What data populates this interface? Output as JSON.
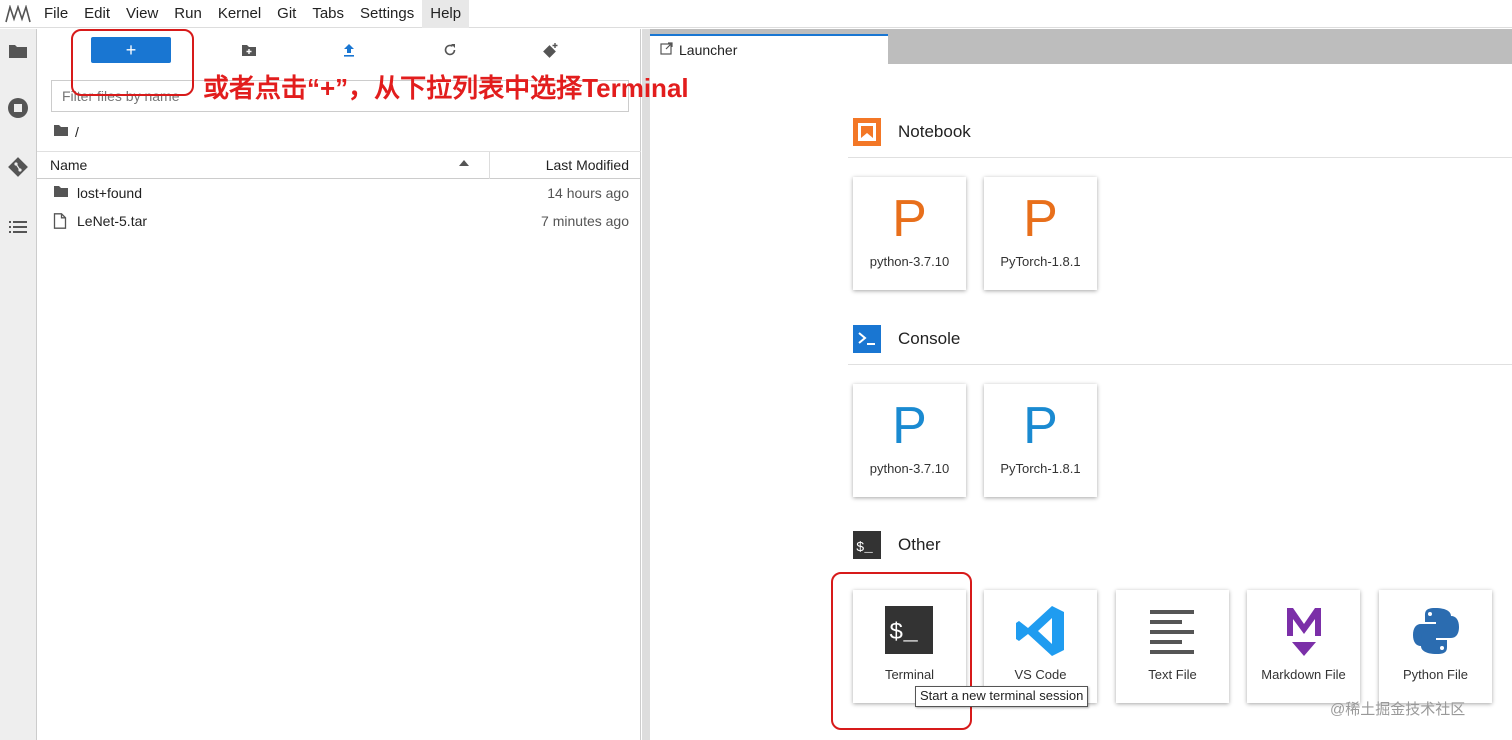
{
  "menu": [
    "File",
    "Edit",
    "View",
    "Run",
    "Kernel",
    "Git",
    "Tabs",
    "Settings",
    "Help"
  ],
  "filebrowser": {
    "new_label": "+",
    "filter_placeholder": "Filter files by name",
    "breadcrumb": "/",
    "columns": {
      "name": "Name",
      "modified": "Last Modified"
    },
    "files": [
      {
        "name": "lost+found",
        "modified": "14 hours ago",
        "type": "folder"
      },
      {
        "name": "LeNet-5.tar",
        "modified": "7 minutes ago",
        "type": "file"
      }
    ]
  },
  "tab": {
    "label": "Launcher"
  },
  "launcher": {
    "notebook": {
      "title": "Notebook",
      "kernels": [
        {
          "letter": "P",
          "label": "python-3.7.10"
        },
        {
          "letter": "P",
          "label": "PyTorch-1.8.1"
        }
      ]
    },
    "console": {
      "title": "Console",
      "kernels": [
        {
          "letter": "P",
          "label": "python-3.7.10"
        },
        {
          "letter": "P",
          "label": "PyTorch-1.8.1"
        }
      ]
    },
    "other": {
      "title": "Other",
      "items": [
        {
          "label": "Terminal"
        },
        {
          "label": "VS Code"
        },
        {
          "label": "Text File"
        },
        {
          "label": "Markdown File"
        },
        {
          "label": "Python File"
        }
      ]
    }
  },
  "tooltip": "Start a new terminal session",
  "annotation": "或者点击“+”，从下拉列表中选择Terminal",
  "watermark": "@稀土掘金技术社区",
  "colors": {
    "accent": "#1976d2",
    "notebook_p": "#e86f1b",
    "console_p": "#1a8ad1",
    "annotation": "#e21d1d"
  }
}
